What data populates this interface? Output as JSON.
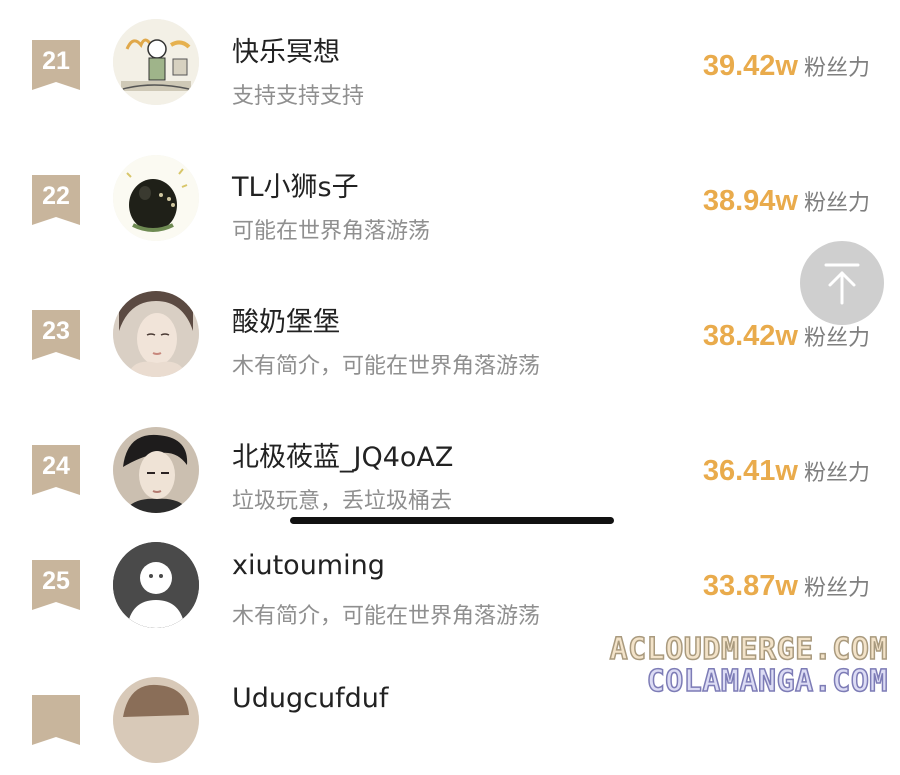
{
  "list": [
    {
      "rank": "21",
      "name": "快乐冥想",
      "bio": "支持支持支持",
      "count": "39.42w",
      "unit": "粉丝力"
    },
    {
      "rank": "22",
      "name": "TL小狮s子",
      "bio": "可能在世界角落游荡",
      "count": "38.94w",
      "unit": "粉丝力"
    },
    {
      "rank": "23",
      "name": "酸奶堡堡",
      "bio": "木有简介，可能在世界角落游荡",
      "count": "38.42w",
      "unit": "粉丝力"
    },
    {
      "rank": "24",
      "name": "北极莜蓝_JQ4oAZ",
      "bio": "垃圾玩意，丢垃圾桶去",
      "count": "36.41w",
      "unit": "粉丝力"
    },
    {
      "rank": "25",
      "name": "xiutouming",
      "bio": "木有简介，可能在世界角落游荡",
      "count": "33.87w",
      "unit": "粉丝力"
    },
    {
      "rank": "",
      "name": "Udugcufduf",
      "bio": "",
      "count": "",
      "unit": ""
    }
  ],
  "scroll_top_icon": "arrow-up-to-top-icon",
  "watermark": {
    "line1": "ACLOUDMERGE.COM",
    "line2": "COLAMANGA.COM"
  },
  "colors": {
    "rank_badge": "#c8b59c",
    "fan_count": "#e9ab4c",
    "bio": "#8f8f8f"
  }
}
